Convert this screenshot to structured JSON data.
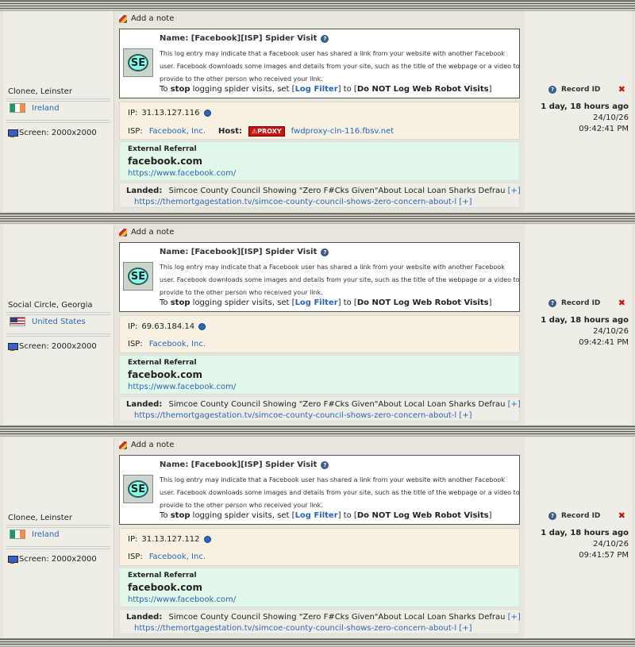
{
  "common": {
    "add_note": "Add a note",
    "spider_name": "Name: [Facebook][ISP] Spider Visit",
    "spider_desc": "This log entry may indicate that a Facebook user has shared a link from your website with another Facebook user. Facebook downloads some images and details from your site, such as the title of the webpage or a video to provide to the other person who received your link.",
    "stop_prefix": "To ",
    "stop_bold": "stop",
    "stop_mid": " logging spider visits, set [",
    "log_filter": "Log Filter",
    "stop_to": "] to [",
    "do_not_log": "Do NOT Log Web Robot Visits",
    "stop_end": "]",
    "se_label": "SE",
    "ip_label": "IP:",
    "isp_label": "ISP:",
    "host_label": "Host:",
    "proxy_label": "PROXY",
    "ref_title": "External Referral",
    "ref_domain": "facebook.com",
    "ref_url": "https://www.facebook.com/",
    "landed_label": "Landed:",
    "landed_title": "Simcoe County Council Showing \"Zero F#Cks Given\"About Local Loan Sharks Defrau",
    "expand": "[+]",
    "landed_url": "https://themortgagestation.tv/simcoe-county-council-shows-zero-concern-about-l",
    "record_id": "Record ID",
    "screen": "Screen: 2000x2000",
    "ago": "1 day, 18 hours ago",
    "date": "24/10/26",
    "colors": {
      "link": "#2a66b8",
      "ref_bg": "#e0f7ea",
      "ip_bg": "#f6f1e3",
      "delete": "#cc1111"
    }
  },
  "records": [
    {
      "location": "Clonee, Leinster",
      "country": "Ireland",
      "flag": "ireland-flag-icon",
      "ip": "31.13.127.116",
      "isp": "Facebook, Inc.",
      "host": "fwdproxy-cln-116.fbsv.net",
      "time": "09:42:41 PM"
    },
    {
      "location": "Social Circle, Georgia",
      "country": "United States",
      "flag": "us-flag-icon",
      "ip": "69.63.184.14",
      "isp": "Facebook, Inc.",
      "host": "",
      "time": "09:42:41 PM"
    },
    {
      "location": "Clonee, Leinster",
      "country": "Ireland",
      "flag": "ireland-flag-icon",
      "ip": "31.13.127.112",
      "isp": "Facebook, Inc.",
      "host": "",
      "time": "09:41:57 PM"
    }
  ]
}
